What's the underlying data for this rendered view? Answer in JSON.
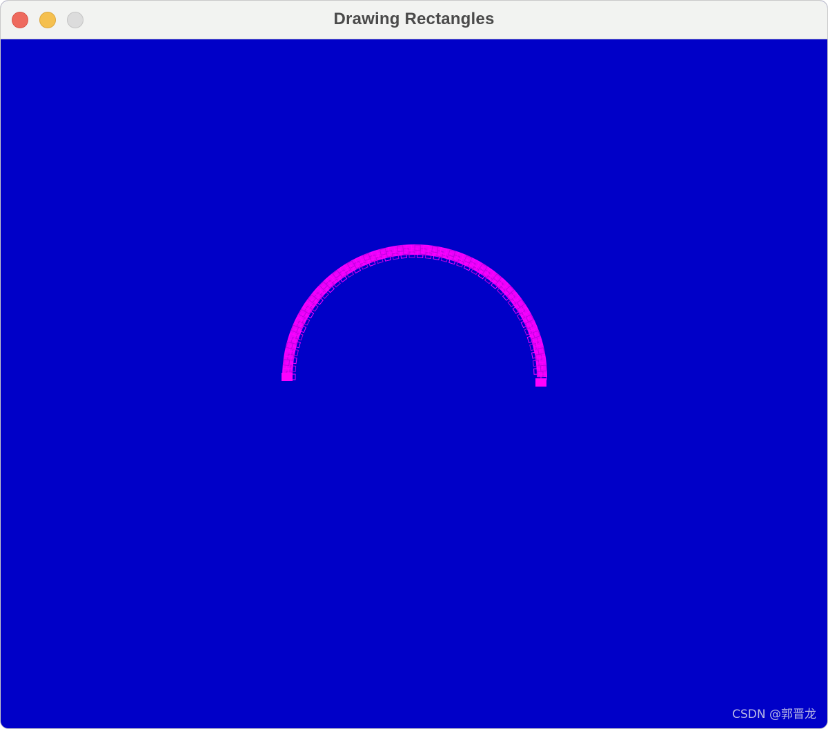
{
  "window": {
    "title": "Drawing Rectangles"
  },
  "titlebar": {
    "buttons": [
      {
        "name": "close-button",
        "color": "#ee6a5e"
      },
      {
        "name": "minimize-button",
        "color": "#f5c04f"
      },
      {
        "name": "zoom-button",
        "color": "#dcdcdc"
      }
    ]
  },
  "canvas": {
    "background_color": "#0000c8",
    "arc_color": "#ff00ff",
    "shape": "semicircular-arc-of-rectangles"
  },
  "watermark": {
    "text": "CSDN @郭晋龙"
  }
}
